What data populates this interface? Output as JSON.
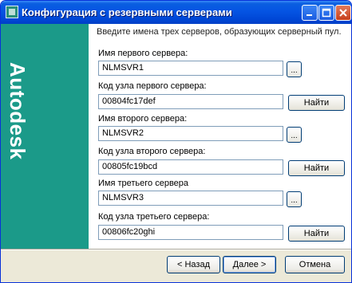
{
  "window": {
    "title": "Конфигурация с резервными серверами"
  },
  "banner": {
    "text": "Autodesk"
  },
  "intro": "Введите имена трех серверов, образующих серверный пул.",
  "servers": [
    {
      "name_label": "Имя первого сервера:",
      "name_value": "NLMSVR1",
      "browse_label": "...",
      "host_label": "Код узла первого сервера:",
      "host_value": "00804fc17def",
      "find_label": "Найти"
    },
    {
      "name_label": "Имя второго сервера:",
      "name_value": "NLMSVR2",
      "browse_label": "...",
      "host_label": "Код узла второго сервера:",
      "host_value": "00805fc19bcd",
      "find_label": "Найти"
    },
    {
      "name_label": "Имя третьего сервера",
      "name_value": "NLMSVR3",
      "browse_label": "...",
      "host_label": "Код узла третьего сервера:",
      "host_value": "00806fc20ghi",
      "find_label": "Найти"
    }
  ],
  "buttons": {
    "back": "< Назад",
    "next": "Далее >",
    "cancel": "Отмена"
  }
}
